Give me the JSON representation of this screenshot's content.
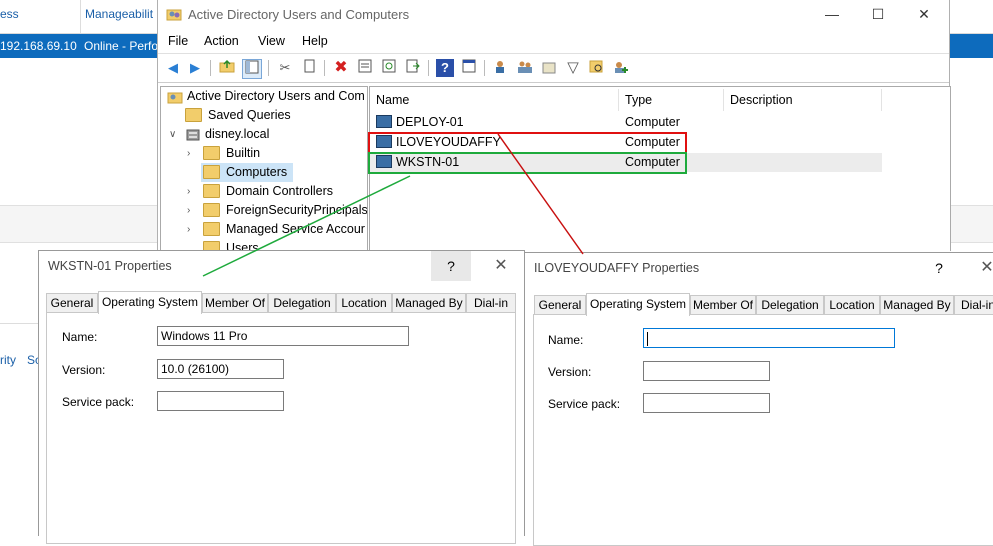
{
  "background": {
    "col1": "ess",
    "col2": "Manageabilit",
    "row_ip": "192.168.69.10",
    "row_status": "Online - Perfo",
    "side1": "rity",
    "side2": "Sc"
  },
  "aduc": {
    "title": "Active Directory Users and Computers",
    "menu": [
      "File",
      "Action",
      "View",
      "Help"
    ],
    "tree": {
      "root": "Active Directory Users and Com",
      "saved_queries": "Saved Queries",
      "domain": "disney.local",
      "builtin": "Builtin",
      "computers": "Computers",
      "dcs": "Domain Controllers",
      "fsp": "ForeignSecurityPrincipals",
      "msa": "Managed Service Accour",
      "users": "Users"
    },
    "columns": {
      "name": "Name",
      "type": "Type",
      "description": "Description"
    },
    "rows": [
      {
        "name": "DEPLOY-01",
        "type": "Computer",
        "description": ""
      },
      {
        "name": "ILOVEYOUDAFFY",
        "type": "Computer",
        "description": ""
      },
      {
        "name": "WKSTN-01",
        "type": "Computer",
        "description": ""
      }
    ]
  },
  "dialog_left": {
    "title": "WKSTN-01 Properties",
    "help": "?",
    "close": "✕",
    "tabs": [
      "General",
      "Operating System",
      "Member Of",
      "Delegation",
      "Location",
      "Managed By",
      "Dial-in"
    ],
    "active_tab": "Operating System",
    "fields": {
      "name_label": "Name:",
      "name_value": "Windows 11 Pro",
      "version_label": "Version:",
      "version_value": "10.0 (26100)",
      "sp_label": "Service pack:",
      "sp_value": ""
    }
  },
  "dialog_right": {
    "title": "ILOVEYOUDAFFY Properties",
    "help": "?",
    "close": "✕",
    "tabs": [
      "General",
      "Operating System",
      "Member Of",
      "Delegation",
      "Location",
      "Managed By",
      "Dial-in"
    ],
    "active_tab": "Operating System",
    "fields": {
      "name_label": "Name:",
      "name_value": "",
      "version_label": "Version:",
      "version_value": "",
      "sp_label": "Service pack:",
      "sp_value": ""
    }
  },
  "annotations": {
    "red": "#e01010",
    "green": "#1eaa3c"
  }
}
